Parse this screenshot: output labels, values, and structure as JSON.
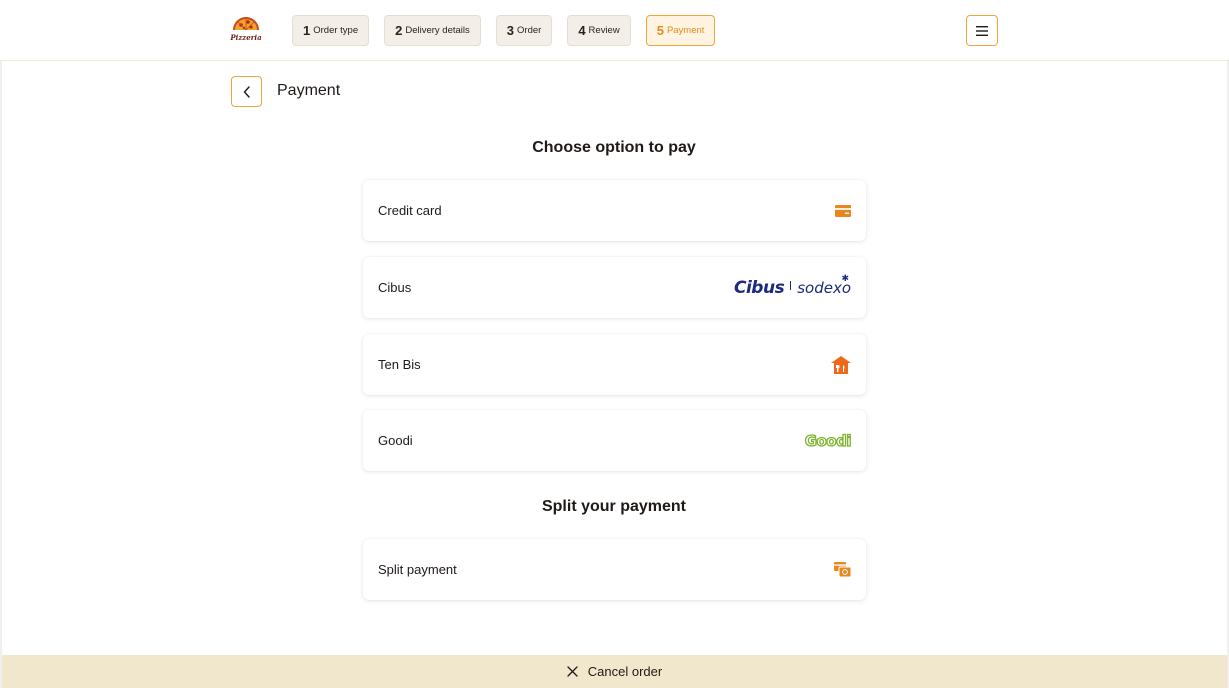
{
  "header": {
    "logo_text": "Pizzeria",
    "steps": [
      {
        "num": "1",
        "label": "Order type"
      },
      {
        "num": "2",
        "label": "Delivery details"
      },
      {
        "num": "3",
        "label": "Order"
      },
      {
        "num": "4",
        "label": "Review"
      },
      {
        "num": "5",
        "label": "Payment"
      }
    ],
    "active_step": 5,
    "menu_icon": "hamburger-menu-icon"
  },
  "page": {
    "title": "Payment",
    "back_icon": "chevron-left-icon"
  },
  "pay_options": {
    "heading": "Choose option to pay",
    "items": [
      {
        "label": "Credit card",
        "icon": "credit-card-icon"
      },
      {
        "label": "Cibus",
        "logo_main": "Cibus",
        "logo_partner": "sodexo"
      },
      {
        "label": "Ten Bis",
        "icon": "tenbis-logo-icon"
      },
      {
        "label": "Goodi",
        "logo": "Goodi"
      }
    ]
  },
  "split": {
    "heading": "Split your payment",
    "items": [
      {
        "label": "Split payment",
        "icon": "split-payment-icon"
      }
    ]
  },
  "footer": {
    "cancel_label": "Cancel order",
    "cancel_icon": "close-icon"
  },
  "colors": {
    "accent": "#f0a43c",
    "accent_text": "#e88a1a",
    "icon_orange": "#e8861f",
    "footer_bg": "#f1e7cc",
    "cibus_blue": "#1d2a80",
    "goodi_green": "#7cb62e"
  }
}
